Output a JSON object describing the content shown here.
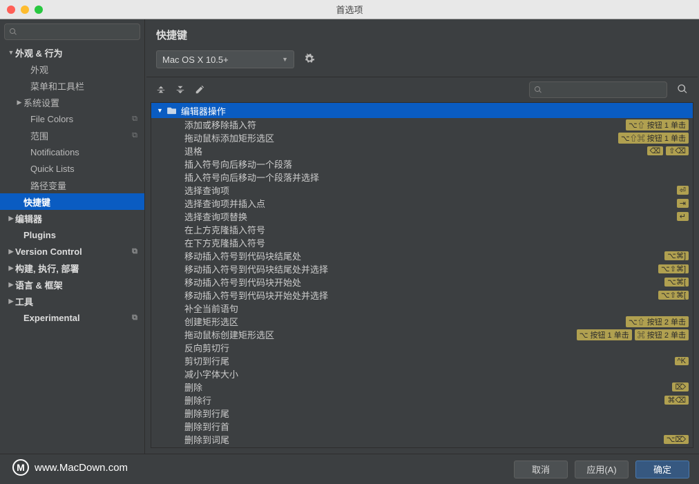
{
  "window": {
    "title": "首选项"
  },
  "sidebar": {
    "search_placeholder": "",
    "items": [
      {
        "label": "外观 & 行为",
        "level": 0,
        "arrow": "down",
        "copy": false
      },
      {
        "label": "外观",
        "level": 1,
        "copy": false
      },
      {
        "label": "菜单和工具栏",
        "level": 1,
        "copy": false
      },
      {
        "label": "系统设置",
        "level": 1,
        "arrow": "right",
        "copy": false,
        "l1b": true
      },
      {
        "label": "File Colors",
        "level": 1,
        "copy": true
      },
      {
        "label": "范围",
        "level": 1,
        "copy": true
      },
      {
        "label": "Notifications",
        "level": 1,
        "copy": false
      },
      {
        "label": "Quick Lists",
        "level": 1,
        "copy": false
      },
      {
        "label": "路径变量",
        "level": 1,
        "copy": false
      },
      {
        "label": "快捷键",
        "level": 0,
        "selected": true,
        "noarrow": true
      },
      {
        "label": "编辑器",
        "level": 0,
        "arrow": "right"
      },
      {
        "label": "Plugins",
        "level": 0,
        "noarrow": true
      },
      {
        "label": "Version Control",
        "level": 0,
        "arrow": "right",
        "copy": true
      },
      {
        "label": "构建, 执行, 部署",
        "level": 0,
        "arrow": "right"
      },
      {
        "label": "语言 & 框架",
        "level": 0,
        "arrow": "right"
      },
      {
        "label": "工具",
        "level": 0,
        "arrow": "right"
      },
      {
        "label": "Experimental",
        "level": 0,
        "noarrow": true,
        "copy": true
      }
    ]
  },
  "content": {
    "title": "快捷键",
    "scheme": "Mac OS X 10.5+",
    "group": "编辑器操作",
    "actions": [
      {
        "label": "添加或移除插入符",
        "shortcuts": [
          "⌥⇧ 按钮 1 单击"
        ]
      },
      {
        "label": "拖动鼠标添加矩形选区",
        "shortcuts": [
          "⌥⇧⌘ 按钮 1 单击"
        ]
      },
      {
        "label": "退格",
        "shortcuts": [
          "⌫",
          "⇧⌫"
        ]
      },
      {
        "label": "插入符号向后移动一个段落",
        "shortcuts": []
      },
      {
        "label": "插入符号向后移动一个段落并选择",
        "shortcuts": []
      },
      {
        "label": "选择查询项",
        "shortcuts": [
          "⏎"
        ]
      },
      {
        "label": "选择查询项并插入点",
        "shortcuts": [
          "⇥"
        ]
      },
      {
        "label": "选择查询项替换",
        "shortcuts": [
          "↵"
        ]
      },
      {
        "label": "在上方克隆插入符号",
        "shortcuts": []
      },
      {
        "label": "在下方克隆插入符号",
        "shortcuts": []
      },
      {
        "label": "移动插入符号到代码块结尾处",
        "shortcuts": [
          "⌥⌘]"
        ]
      },
      {
        "label": "移动插入符号到代码块结尾处并选择",
        "shortcuts": [
          "⌥⇧⌘]"
        ]
      },
      {
        "label": "移动插入符号到代码块开始处",
        "shortcuts": [
          "⌥⌘["
        ]
      },
      {
        "label": "移动插入符号到代码块开始处并选择",
        "shortcuts": [
          "⌥⇧⌘["
        ]
      },
      {
        "label": "补全当前语句",
        "shortcuts": []
      },
      {
        "label": "创建矩形选区",
        "shortcuts": [
          "⌥⇧ 按钮 2 单击"
        ]
      },
      {
        "label": "拖动鼠标创建矩形选区",
        "shortcuts": [
          "⌥ 按钮 1 单击",
          "⌘ 按钮 2 单击"
        ]
      },
      {
        "label": "反向剪切行",
        "shortcuts": []
      },
      {
        "label": "剪切到行尾",
        "shortcuts": [
          "^K"
        ]
      },
      {
        "label": "减小字体大小",
        "shortcuts": []
      },
      {
        "label": "删除",
        "shortcuts": [
          "⌦"
        ]
      },
      {
        "label": "删除行",
        "shortcuts": [
          "⌘⌫"
        ]
      },
      {
        "label": "删除到行尾",
        "shortcuts": []
      },
      {
        "label": "删除到行首",
        "shortcuts": []
      },
      {
        "label": "删除到词尾",
        "shortcuts": [
          "⌥⌦"
        ]
      }
    ]
  },
  "footer": {
    "cancel": "取消",
    "apply": "应用(A)",
    "ok": "确定"
  },
  "watermark": {
    "text": "www.MacDown.com",
    "logo": "M"
  }
}
